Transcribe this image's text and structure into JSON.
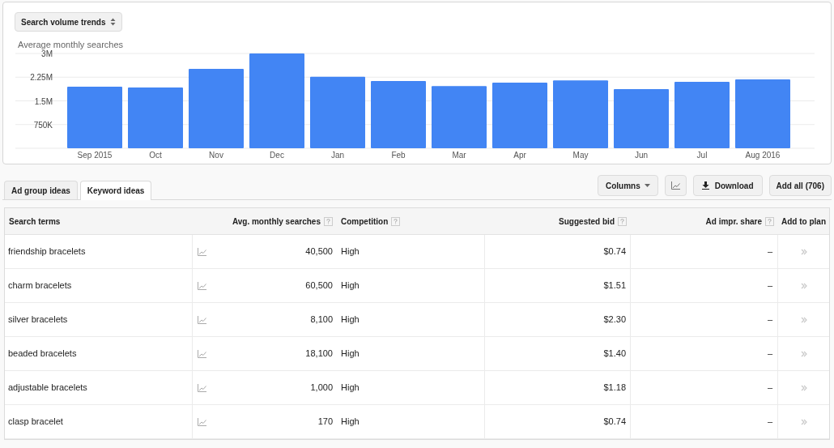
{
  "trend_panel": {
    "selector": "Search volume trends",
    "chart_data": {
      "type": "bar",
      "ylabel": "Average monthly searches",
      "categories": [
        "Sep 2015",
        "Oct",
        "Nov",
        "Dec",
        "Jan",
        "Feb",
        "Mar",
        "Apr",
        "May",
        "Jun",
        "Jul",
        "Aug 2016"
      ],
      "grid": true,
      "series": [
        {
          "color": "#4285f4",
          "values": [
            1950000,
            1920000,
            2510000,
            3000000,
            2260000,
            2130000,
            1970000,
            2080000,
            2150000,
            1870000,
            2100000,
            2180000
          ]
        }
      ],
      "ylim": [
        0,
        3000000
      ],
      "yticks": [
        {
          "value": 750000,
          "label": "750K"
        },
        {
          "value": 1500000,
          "label": "1.5M"
        },
        {
          "value": 2250000,
          "label": "2.25M"
        },
        {
          "value": 3000000,
          "label": "3M"
        }
      ]
    }
  },
  "tabs": [
    {
      "label": "Ad group ideas",
      "selected": false
    },
    {
      "label": "Keyword ideas",
      "selected": true
    }
  ],
  "toolbar": {
    "columns": "Columns",
    "download": "Download",
    "add_all": "Add all (706)"
  },
  "table": {
    "columns": [
      "Search terms",
      "Avg. monthly searches",
      "Competition",
      "Suggested bid",
      "Ad impr. share",
      "Add to plan"
    ],
    "rows": [
      {
        "term": "friendship bracelets",
        "searches": "40,500",
        "competition": "High",
        "bid": "$0.74",
        "share": "–"
      },
      {
        "term": "charm bracelets",
        "searches": "60,500",
        "competition": "High",
        "bid": "$1.51",
        "share": "–"
      },
      {
        "term": "silver bracelets",
        "searches": "8,100",
        "competition": "High",
        "bid": "$2.30",
        "share": "–"
      },
      {
        "term": "beaded bracelets",
        "searches": "18,100",
        "competition": "High",
        "bid": "$1.40",
        "share": "–"
      },
      {
        "term": "adjustable bracelets",
        "searches": "1,000",
        "competition": "High",
        "bid": "$1.18",
        "share": "–"
      },
      {
        "term": "clasp bracelet",
        "searches": "170",
        "competition": "High",
        "bid": "$0.74",
        "share": "–"
      }
    ]
  }
}
